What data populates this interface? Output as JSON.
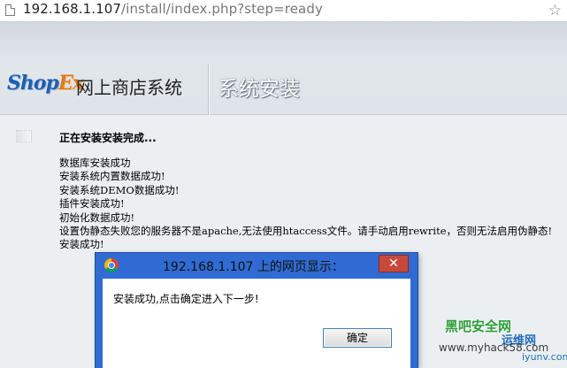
{
  "browser": {
    "url_host": "192.168.1.107",
    "url_path": "/install/index.php?step=ready"
  },
  "header": {
    "logo_shop": "Shop",
    "logo_ex": "Ex",
    "system_name": "网上商店系统",
    "title": "系统安装"
  },
  "content": {
    "heading": "正在安装安装完成...",
    "log": [
      "数据库安装成功",
      "安装系统内置数据成功!",
      "安装系统DEMO数据成功!",
      "插件安装成功!",
      "初始化数据成功!",
      "设置伪静态失败您的服务器不是apache,无法使用htaccess文件。请手动启用rewrite，否则无法启用伪静态!",
      "安装成功!"
    ]
  },
  "dialog": {
    "title": "192.168.1.107 上的网页显示：",
    "message": "安装成功,点击确定进入下一步!",
    "ok_label": "确定",
    "close_glyph": "✕"
  },
  "watermark": {
    "line1": "黑吧安全网",
    "line2": "运维网",
    "line3": "www.myhack58.com",
    "line4": "iyunv.com"
  }
}
